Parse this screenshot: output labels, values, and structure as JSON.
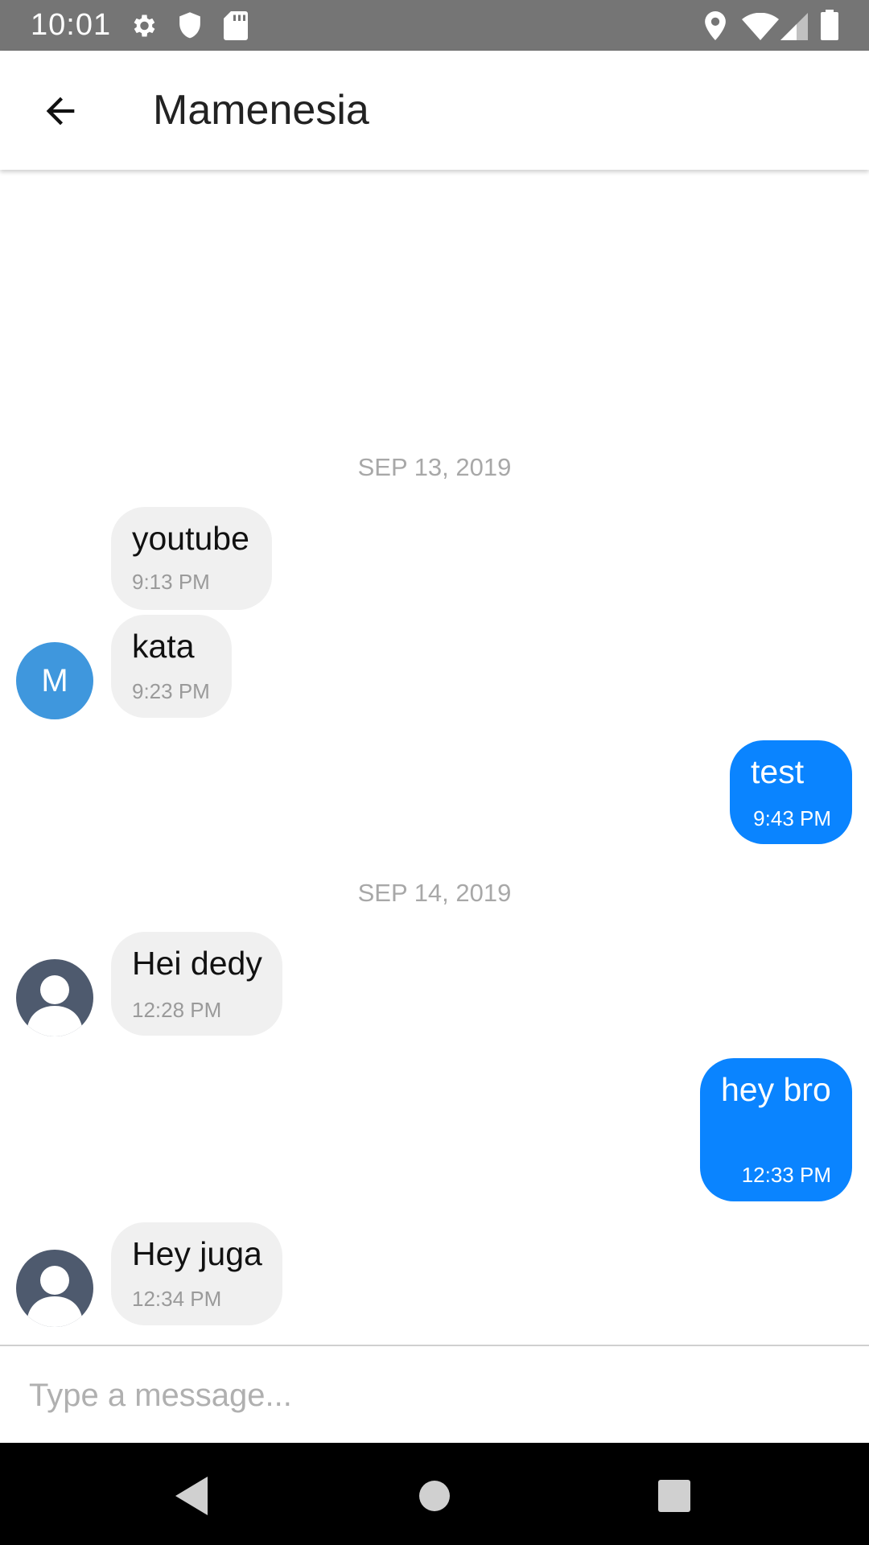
{
  "status_bar": {
    "time": "10:01",
    "icons": [
      "gear-icon",
      "shield-icon",
      "sd-card-icon",
      "location-icon",
      "wifi-icon",
      "signal-icon",
      "battery-icon"
    ]
  },
  "app_bar": {
    "back_icon": "arrow-left-icon",
    "title": "Mamenesia"
  },
  "conversation": {
    "date_separators": [
      "SEP 13, 2019",
      "SEP 14, 2019"
    ],
    "messages": [
      {
        "direction": "incoming",
        "text": "youtube",
        "time": "9:13 PM"
      },
      {
        "direction": "incoming",
        "text": "kata",
        "time": "9:23 PM",
        "avatar": "M"
      },
      {
        "direction": "outgoing",
        "text": "test",
        "time": "9:43 PM"
      },
      {
        "direction": "incoming",
        "text": "Hei dedy",
        "time": "12:28 PM",
        "avatar": "person-icon"
      },
      {
        "direction": "outgoing",
        "text": "hey bro",
        "time": "12:33 PM"
      },
      {
        "direction": "incoming",
        "text": "Hey juga",
        "time": "12:34 PM",
        "avatar": "person-icon"
      }
    ]
  },
  "composer": {
    "value": "",
    "placeholder": "Type a message..."
  },
  "colors": {
    "status_bar": "#757575",
    "outgoing_bubble": "#0a84ff",
    "incoming_bubble": "#f0f0f0",
    "avatar_letter_bg": "#3f97dd",
    "avatar_person_bg": "#4e5a6e"
  },
  "nav_bar": {
    "buttons": [
      "back-triangle-icon",
      "home-circle-icon",
      "recents-square-icon"
    ]
  }
}
